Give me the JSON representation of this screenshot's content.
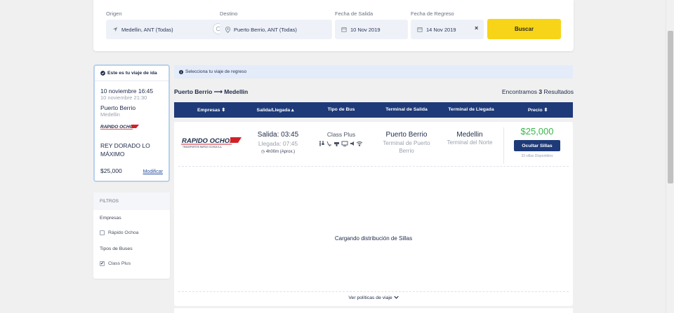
{
  "search": {
    "origin_label": "Origen",
    "origin_value": "Medellin, ANT (Todas)",
    "destination_label": "Destino",
    "destination_value": "Puerto Berrio, ANT (Todas)",
    "departure_label": "Fecha de Salida",
    "departure_value": "10 Nov 2019",
    "return_label": "Fecha de Regreso",
    "return_value": "14 Nov 2019",
    "clear_symbol": "×",
    "button_label": "Buscar"
  },
  "outbound": {
    "header": "Este es tu viaje de ida",
    "departure_datetime": "10 noviembre 16:45",
    "arrival_datetime": "10 noviembre 21:30",
    "origin": "Puerto Berrio",
    "destination": "Medellin",
    "bus_name": "REY DORADO LO MÁXIMO",
    "price": "$25,000",
    "modify_label": "Modificar"
  },
  "filters": {
    "title": "FILTROS",
    "companies_label": "Empresas",
    "companies": [
      {
        "label": "Rápido Ochoa",
        "checked": false
      }
    ],
    "bus_types_label": "Tipos de Buses",
    "bus_types": [
      {
        "label": "Class Plus",
        "checked": true
      }
    ]
  },
  "results": {
    "notice": "Selecciona tu viaje de regreso",
    "route": "Puerto Berrio ⟶ Medellin",
    "found_prefix": "Encontramos",
    "found_count": "3",
    "found_suffix": "Resultados",
    "columns": [
      "Empresas ⬍",
      "Salida/Llegada ▴",
      "Tipo de Bus",
      "Terminal de Salida",
      "Terminal de Llegada",
      "Precio ⬍"
    ],
    "trip": {
      "company_logo_text": "RAPIDO OCHOA",
      "company_logo_subtext": "TRANSPORTES RAPIDO OCHOA S.A.",
      "departure": "Salida: 03:45",
      "arrival": "Llegada: 07:45",
      "duration": "4h00m (Aprox.)",
      "bus_type": "Class Plus",
      "amenity_icons": [
        "restroom-icon",
        "reclining-seat-icon",
        "usb-icon",
        "tv-icon",
        "sound-icon",
        "wifi-icon"
      ],
      "terminal_out": "Puerto Berrio",
      "terminal_out_detail": "Terminal de Puerto Berrio",
      "terminal_in": "Medellin",
      "terminal_in_detail": "Terminal del Norte",
      "price": "$25,000",
      "hide_seats_label": "Ocultar Sillas",
      "seats_available": "33 sillas Disponibles"
    },
    "loading_text": "Cargando distribución de Sillas",
    "policies_label": "Ver políticas de viaje"
  },
  "colors": {
    "primary": "#1e3a78",
    "accent_yellow": "#f7d417",
    "price_green": "#3bb54a",
    "logo_red": "#d32027"
  }
}
